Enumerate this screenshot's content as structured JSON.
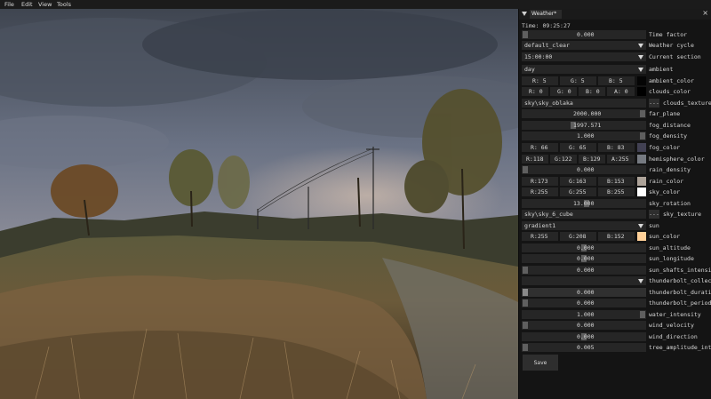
{
  "menubar": {
    "items": [
      "File",
      "Edit",
      "View",
      "Tools"
    ]
  },
  "panel": {
    "tab_title": "Weather*",
    "time_label": "Time",
    "time_value": "09:25:27",
    "save_label": "Save",
    "rows": {
      "time_factor": {
        "value": "0.000",
        "label": "Time factor"
      },
      "weather_cycle": {
        "value": "default_clear",
        "label": "Weather cycle"
      },
      "current_section": {
        "value": "15:00:00",
        "label": "Current section"
      },
      "ambient": {
        "value": "day",
        "label": "ambient"
      },
      "ambient_color": {
        "r": "R: 5",
        "g": "G: 5",
        "b": "B: 5",
        "label": "ambient_color",
        "swatch": "#050505"
      },
      "clouds_color": {
        "r": "R: 0",
        "g": "G: 0",
        "b": "B: 0",
        "a": "A: 0",
        "label": "clouds_color",
        "swatch": "#000000"
      },
      "clouds_texture": {
        "value": "sky\\sky_oblaka",
        "dots": "...",
        "label": "clouds_texture"
      },
      "far_plane": {
        "value": "2000.000",
        "label": "far_plane"
      },
      "fog_distance": {
        "value": "1997.571",
        "label": "fog_distance"
      },
      "fog_density": {
        "value": "1.000",
        "label": "fog_density"
      },
      "fog_color": {
        "r": "R: 66",
        "g": "G: 65",
        "b": "B: 83",
        "label": "fog_color",
        "swatch": "#424153"
      },
      "hemisphere_color": {
        "r": "R:118",
        "g": "G:122",
        "b": "B:129",
        "a": "A:255",
        "label": "hemisphere_color",
        "swatch": "#767a81"
      },
      "rain_density": {
        "value": "0.000",
        "label": "rain_density"
      },
      "rain_color": {
        "r": "R:173",
        "g": "G:163",
        "b": "B:153",
        "label": "rain_color",
        "swatch": "#ada399"
      },
      "sky_color": {
        "r": "R:255",
        "g": "G:255",
        "b": "B:255",
        "label": "sky_color",
        "swatch": "#ffffff"
      },
      "sky_rotation": {
        "value": "13.000",
        "label": "sky_rotation"
      },
      "sky_texture": {
        "value": "sky\\sky_6_cube",
        "dots": "...",
        "label": "sky_texture"
      },
      "sun": {
        "value": "gradient1",
        "label": "sun"
      },
      "sun_color": {
        "r": "R:255",
        "g": "G:208",
        "b": "B:152",
        "label": "sun_color",
        "swatch": "#ffd098"
      },
      "sun_altitude": {
        "value": "0.000",
        "label": "sun_altitude"
      },
      "sun_longitude": {
        "value": "0.000",
        "label": "sun_longitude"
      },
      "sun_shafts_intensity": {
        "value": "0.000",
        "label": "sun_shafts_intensity"
      },
      "thunderbolt_collection": {
        "value": "",
        "label": "thunderbolt_collection"
      },
      "thunderbolt_duration": {
        "value": "0.000",
        "label": "thunderbolt_duration"
      },
      "thunderbolt_period": {
        "value": "0.000",
        "label": "thunderbolt_period"
      },
      "water_intensity": {
        "value": "1.000",
        "label": "water_intensity"
      },
      "wind_velocity": {
        "value": "0.000",
        "label": "wind_velocity"
      },
      "wind_direction": {
        "value": "0.000",
        "label": "wind_direction"
      },
      "tree_amplitude_intensity": {
        "value": "0.005",
        "label": "tree_amplitude_intensi"
      }
    }
  }
}
